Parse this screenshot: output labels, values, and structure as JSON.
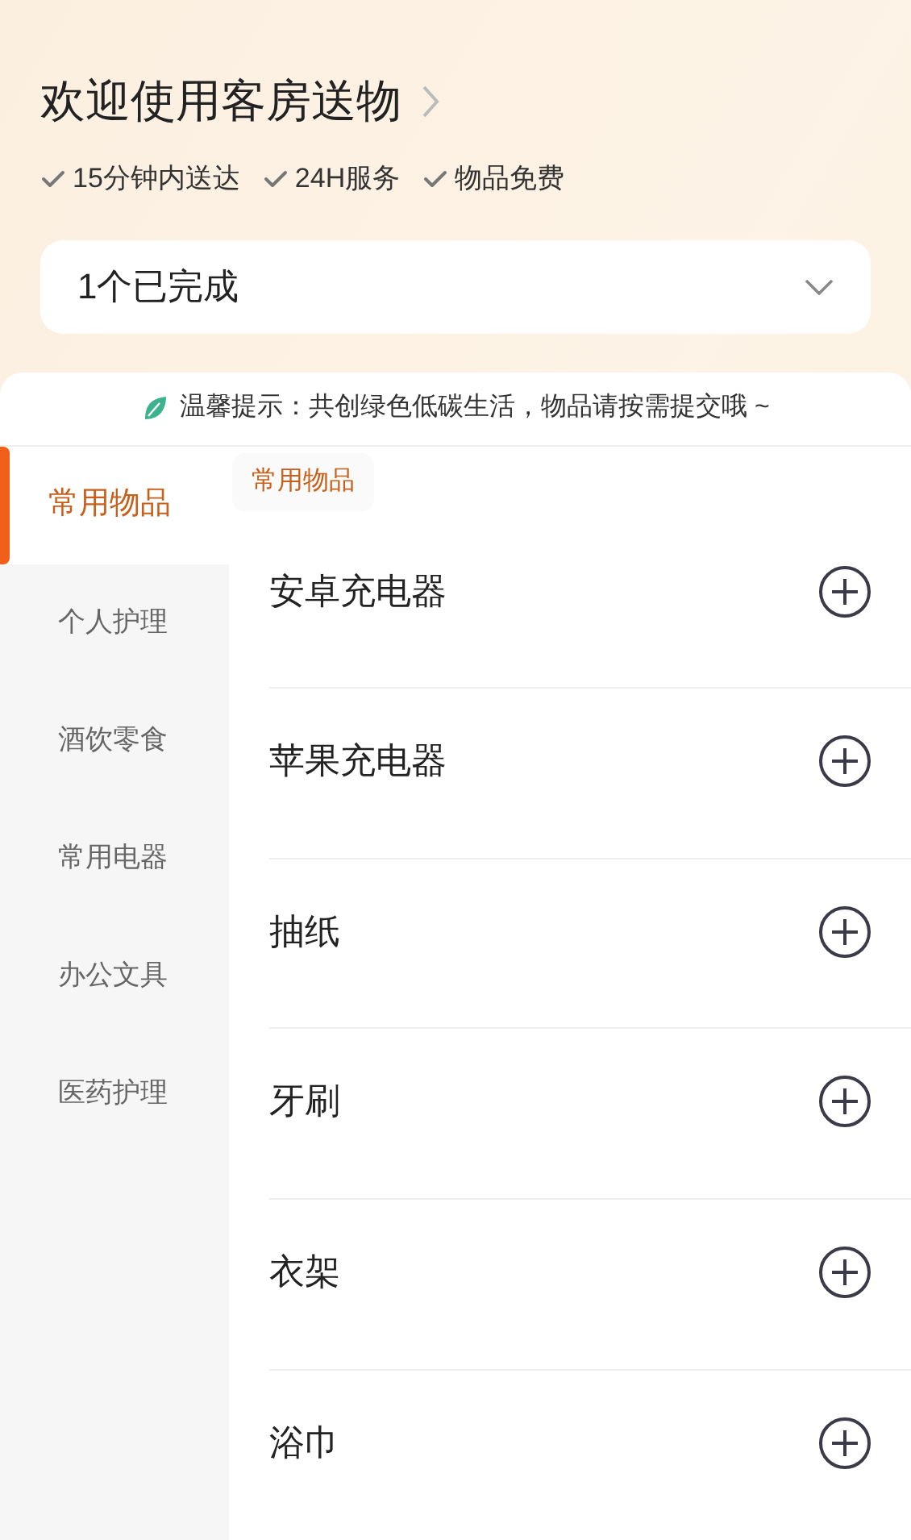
{
  "header": {
    "title": "欢迎使用客房送物",
    "features": [
      "15分钟内送达",
      "24H服务",
      "物品免费"
    ]
  },
  "order_status": {
    "label": "1个已完成",
    "expanded": false
  },
  "notice": "温馨提示：共创绿色低碳生活，物品请按需提交哦 ~",
  "sidebar": {
    "items": [
      {
        "label": "常用物品",
        "selected": true
      },
      {
        "label": "个人护理",
        "selected": false
      },
      {
        "label": "酒饮零食",
        "selected": false
      },
      {
        "label": "常用电器",
        "selected": false
      },
      {
        "label": "办公文具",
        "selected": false
      },
      {
        "label": "医药护理",
        "selected": false
      }
    ]
  },
  "section_title": "常用物品",
  "items": [
    "安卓充电器",
    "苹果充电器",
    "抽纸",
    "牙刷",
    "衣架",
    "浴巾"
  ]
}
